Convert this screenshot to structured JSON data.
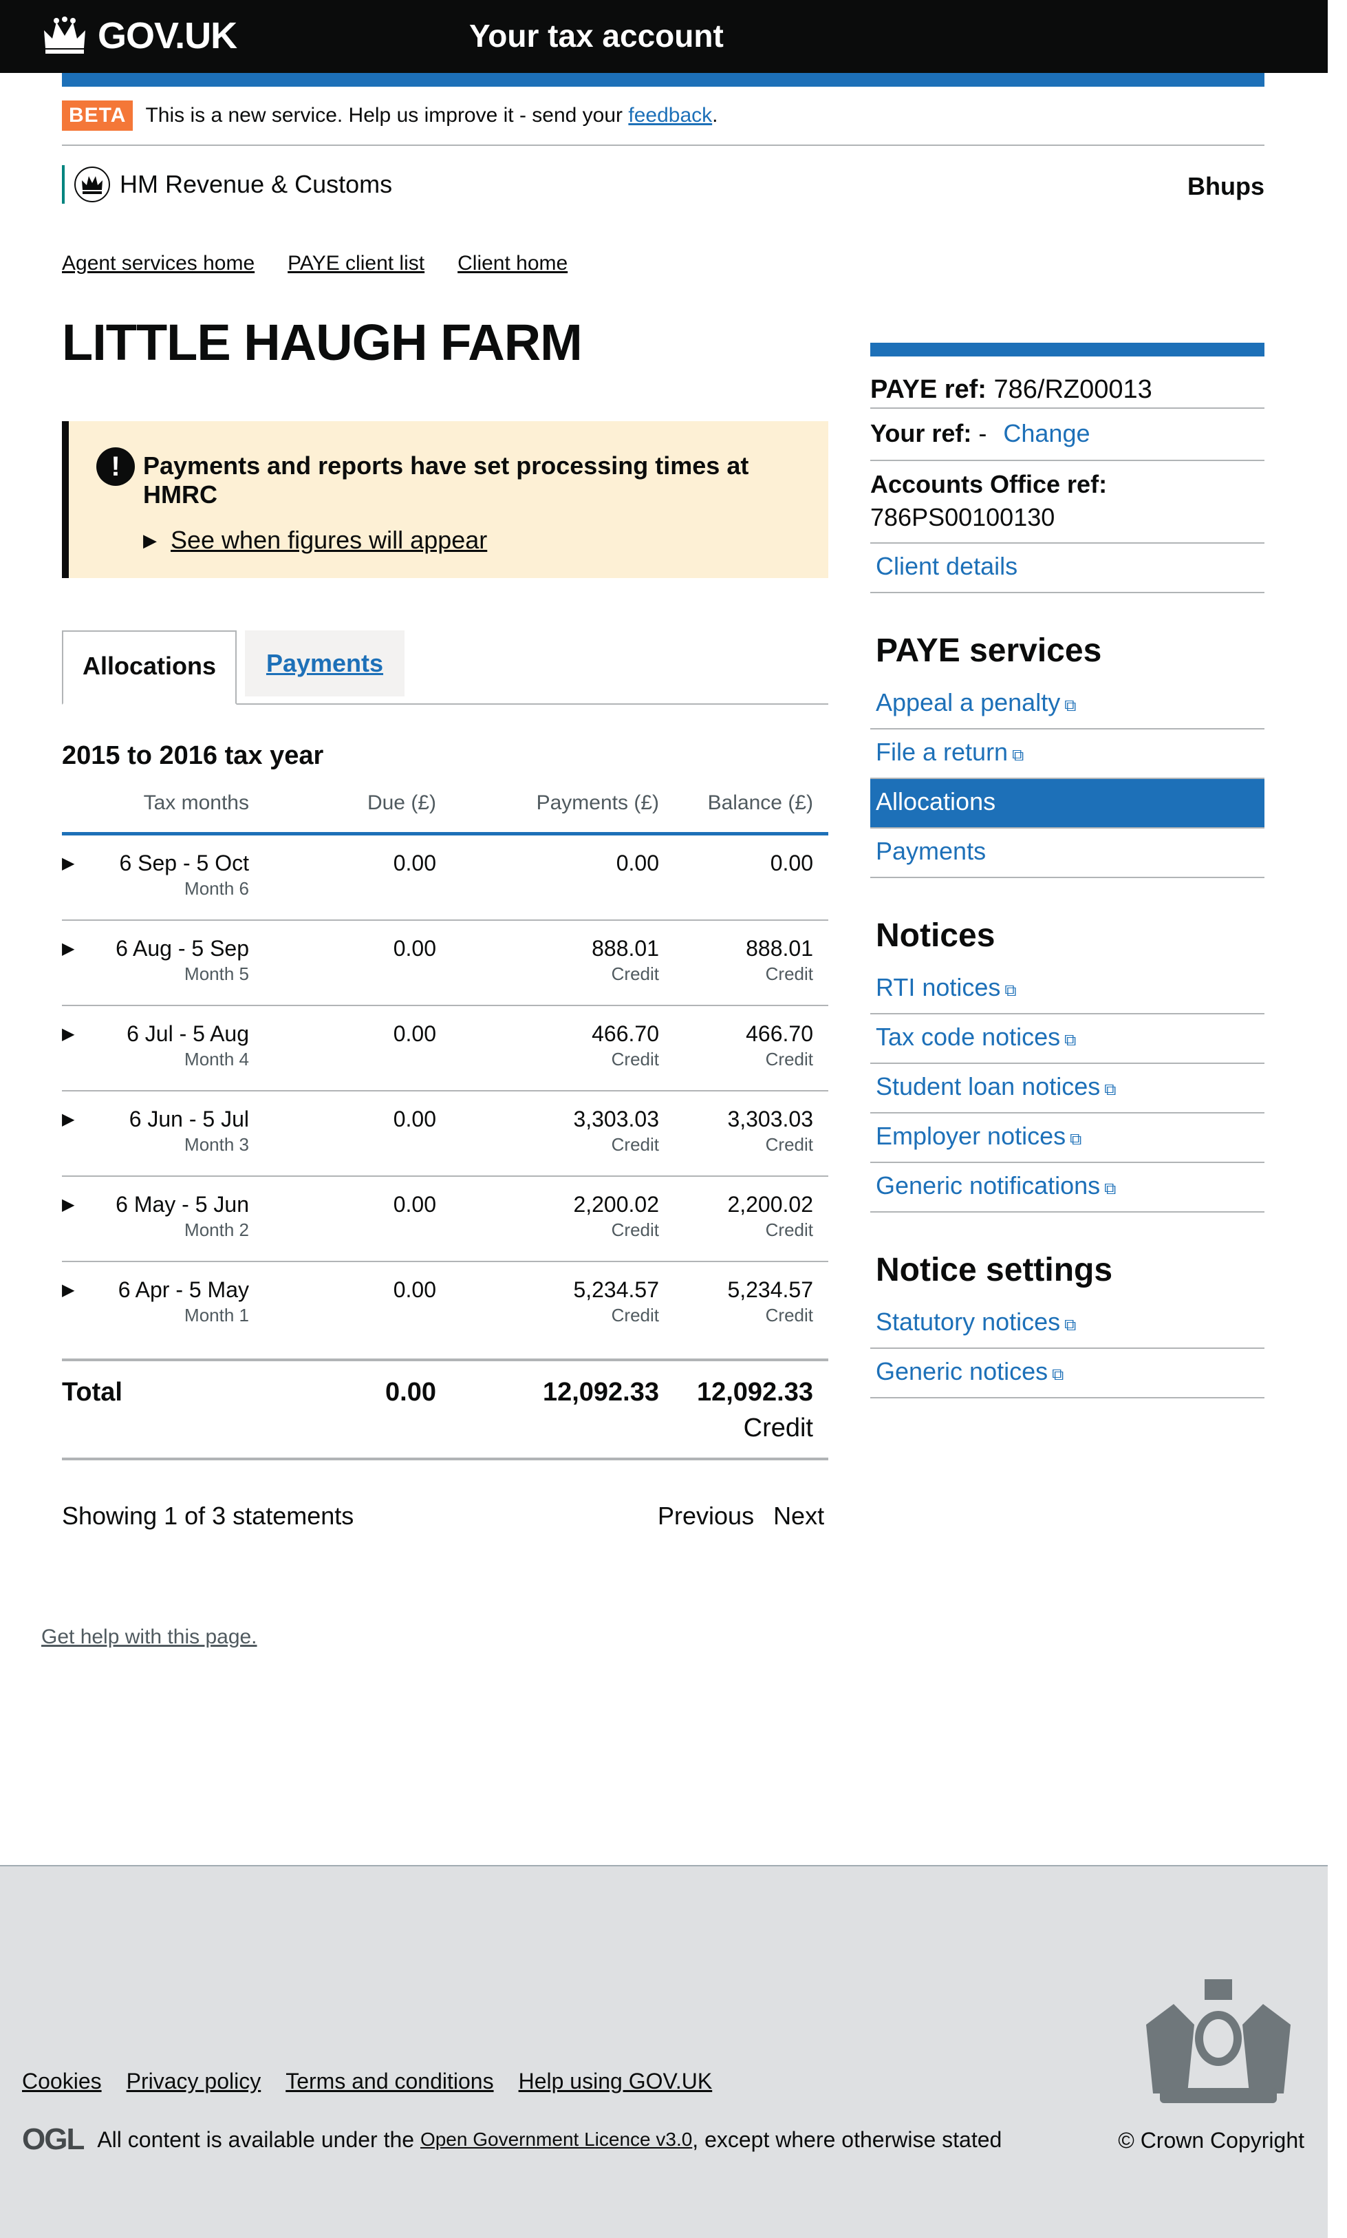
{
  "header": {
    "logo_text": "GOV.UK",
    "service_name": "Your tax account"
  },
  "beta": {
    "tag": "BETA",
    "text": "This is a new service. Help us improve it - send your",
    "link": "feedback",
    "after": "."
  },
  "hmrc": {
    "name": "HM Revenue & Customs",
    "user": "Bhups"
  },
  "breadcrumb": [
    "Agent services home",
    "PAYE client list",
    "Client home"
  ],
  "page_title": "LITTLE HAUGH FARM",
  "warning": {
    "icon": "!",
    "text": "Payments and reports have set processing times at HMRC",
    "details_link": "See when figures will appear"
  },
  "tabs": {
    "allocations": "Allocations",
    "payments": "Payments"
  },
  "table": {
    "tax_year": "2015 to 2016 tax year",
    "headers": [
      "Tax months",
      "Due (£)",
      "Payments (£)",
      "Balance (£)"
    ],
    "rows": [
      {
        "period": "6 Sep - 5 Oct",
        "month": "Month 6",
        "due": "0.00",
        "payments": "0.00",
        "payments_note": "",
        "balance": "0.00",
        "balance_note": ""
      },
      {
        "period": "6 Aug - 5 Sep",
        "month": "Month 5",
        "due": "0.00",
        "payments": "888.01",
        "payments_note": "Credit",
        "balance": "888.01",
        "balance_note": "Credit"
      },
      {
        "period": "6 Jul - 5 Aug",
        "month": "Month 4",
        "due": "0.00",
        "payments": "466.70",
        "payments_note": "Credit",
        "balance": "466.70",
        "balance_note": "Credit"
      },
      {
        "period": "6 Jun - 5 Jul",
        "month": "Month 3",
        "due": "0.00",
        "payments": "3,303.03",
        "payments_note": "Credit",
        "balance": "3,303.03",
        "balance_note": "Credit"
      },
      {
        "period": "6 May - 5 Jun",
        "month": "Month 2",
        "due": "0.00",
        "payments": "2,200.02",
        "payments_note": "Credit",
        "balance": "2,200.02",
        "balance_note": "Credit"
      },
      {
        "period": "6 Apr - 5 May",
        "month": "Month 1",
        "due": "0.00",
        "payments": "5,234.57",
        "payments_note": "Credit",
        "balance": "5,234.57",
        "balance_note": "Credit"
      }
    ],
    "total": {
      "label": "Total",
      "due": "0.00",
      "payments": "12,092.33",
      "balance": "12,092.33",
      "balance_note": "Credit"
    }
  },
  "pagination": {
    "showing": "Showing 1 of 3 statements",
    "previous": "Previous",
    "next": "Next"
  },
  "help_link": "Get help with this page.",
  "sidebar": {
    "paye_ref_label": "PAYE ref:",
    "paye_ref": "786/RZ00013",
    "your_ref_label": "Your ref:",
    "your_ref": "-",
    "change": "Change",
    "accounts_label": "Accounts Office ref:",
    "accounts_ref": "786PS00100130",
    "client_details": "Client details",
    "paye_services": {
      "heading": "PAYE services",
      "items": [
        "Appeal a penalty",
        "File a return",
        "Allocations",
        "Payments"
      ]
    },
    "notices": {
      "heading": "Notices",
      "items": [
        "RTI notices",
        "Tax code notices",
        "Student loan notices",
        "Employer notices",
        "Generic notifications"
      ]
    },
    "notice_settings": {
      "heading": "Notice settings",
      "items": [
        "Statutory notices",
        "Generic notices"
      ]
    }
  },
  "footer": {
    "links": [
      "Cookies",
      "Privacy policy",
      "Terms and conditions",
      "Help using GOV.UK"
    ],
    "ogl_logo": "OGL",
    "licence_pre": "All content is available under the",
    "licence_link": "Open Government Licence v3.0",
    "licence_post": ", except where otherwise stated",
    "copyright": "© Crown Copyright"
  },
  "colors": {
    "brand_blue": "#1d70b8",
    "header_black": "#0b0c0c",
    "beta_orange": "#f47738",
    "warning_bg": "#fdf0d5",
    "footer_bg": "#dee0e2",
    "hmrc_green": "#00847f"
  }
}
